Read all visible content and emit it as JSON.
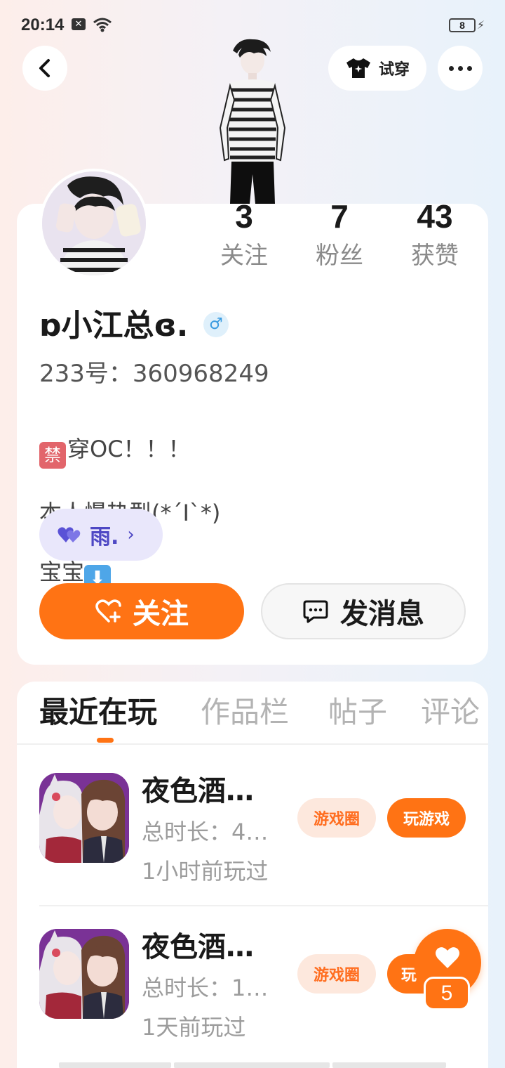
{
  "status_bar": {
    "time": "20:14",
    "notification_icon": "x-box-icon",
    "battery_level": "8"
  },
  "header": {
    "try_on_label": "试穿"
  },
  "profile": {
    "stats": [
      {
        "value": "3",
        "label": "关注"
      },
      {
        "value": "7",
        "label": "粉丝"
      },
      {
        "value": "43",
        "label": "获赞"
      }
    ],
    "nickname": "ɒ小江总ɞ.",
    "gender_symbol": "♂",
    "account_id": "233号：360968249",
    "bio": {
      "line1_emoji": "禁",
      "line1_text": "穿OC！！！",
      "line2": "本人慢热型(*´Ι`*)",
      "line3_text": "宝宝",
      "line3_emoji": "⬇"
    },
    "cp_name": "雨.",
    "follow_label": "关注",
    "message_label": "发消息"
  },
  "tabs": [
    {
      "label": "最近在玩",
      "active": true
    },
    {
      "label": "作品栏",
      "active": false
    },
    {
      "label": "帖子",
      "active": false
    },
    {
      "label": "评论",
      "active": false
    }
  ],
  "games": [
    {
      "title": "夜色酒…",
      "duration": "总时长：4…",
      "last_played": "1小时前玩过",
      "circle_label": "游戏圈",
      "play_label": "玩游戏"
    },
    {
      "title": "夜色酒…",
      "duration": "总时长：1…",
      "last_played": "1天前玩过",
      "circle_label": "游戏圈",
      "play_label": "玩"
    }
  ],
  "floating_like": {
    "count": "5"
  },
  "colors": {
    "accent": "#ff7314",
    "cp_chip_bg": "#e9e7fb",
    "cp_text": "#4e48c4"
  }
}
